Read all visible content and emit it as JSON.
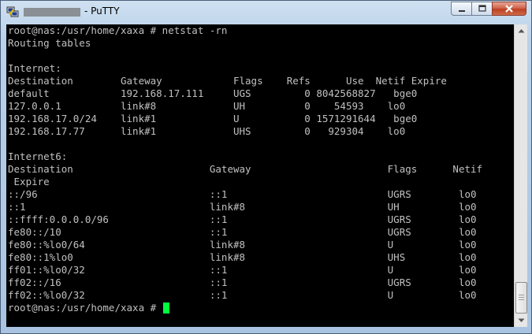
{
  "window": {
    "title": "- PuTTY",
    "icon": "putty-icon"
  },
  "controls": {
    "minimize_icon": "minimize-icon",
    "maximize_icon": "maximize-icon",
    "close_icon": "close-icon"
  },
  "terminal": {
    "lines": [
      "root@nas:/usr/home/xaxa # netstat -rn",
      "Routing tables",
      "",
      "Internet:",
      "Destination        Gateway            Flags    Refs      Use  Netif Expire",
      "default            192.168.17.111     UGS         0 8042568827   bge0",
      "127.0.0.1          link#8             UH          0    54593    lo0",
      "192.168.17.0/24    link#1             U           0 1571291644   bge0",
      "192.168.17.77      link#1             UHS         0   929304    lo0",
      "",
      "Internet6:",
      "Destination                       Gateway                       Flags      Netif",
      " Expire",
      "::/96                             ::1                           UGRS        lo0",
      "::1                               link#8                        UH          lo0",
      "::ffff:0.0.0.0/96                 ::1                           UGRS        lo0",
      "fe80::/10                         ::1                           UGRS        lo0",
      "fe80::%lo0/64                     link#8                        U           lo0",
      "fe80::1%lo0                       link#8                        UHS         lo0",
      "ff01::%lo0/32                     ::1                           U           lo0",
      "ff02::/16                         ::1                           UGRS        lo0",
      "ff02::%lo0/32                     ::1                           U           lo0"
    ],
    "prompt": "root@nas:/usr/home/xaxa # ",
    "cursor_color": "#00ff3f",
    "foreground_color": "#c0c0c0",
    "background_color": "#000000"
  },
  "scrollbar": {
    "up_icon": "scroll-up-arrow-icon",
    "down_icon": "scroll-down-arrow-icon"
  }
}
